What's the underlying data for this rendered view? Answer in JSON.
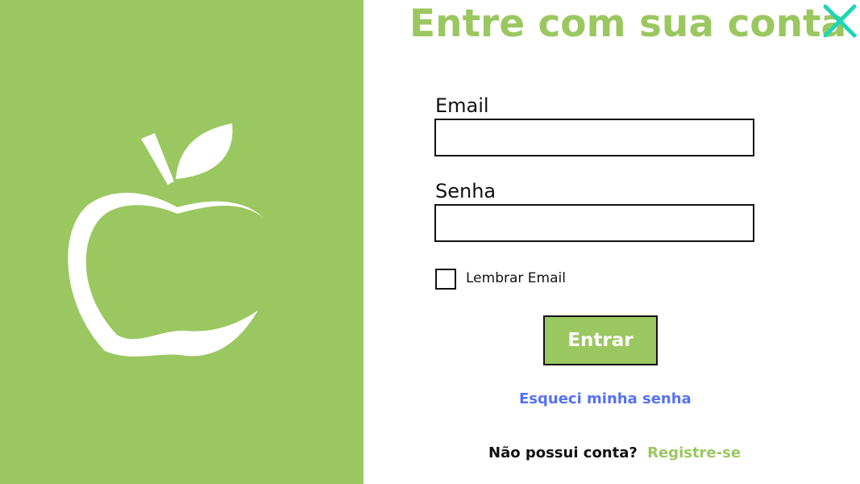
{
  "colors": {
    "brand_green": "#9bc760",
    "close_teal": "#1dd6b8",
    "link_blue": "#5571f5",
    "text_dark": "#111111",
    "background": "#ffffff"
  },
  "brand": {
    "logo_icon": "apple-icon"
  },
  "header": {
    "title": "Entre com sua conta",
    "close_icon": "close-icon"
  },
  "form": {
    "email_label": "Email",
    "email_value": "",
    "email_placeholder": "",
    "password_label": "Senha",
    "password_value": "",
    "password_placeholder": "",
    "remember_label": "Lembrar Email",
    "remember_checked": false,
    "submit_label": "Entrar"
  },
  "links": {
    "forgot_password": "Esqueci minha senha",
    "no_account_prompt": "Não possui conta?",
    "register": "Registre-se"
  }
}
